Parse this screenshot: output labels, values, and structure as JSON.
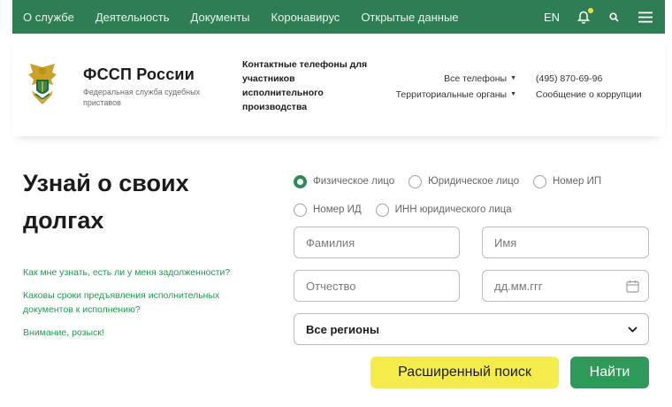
{
  "nav": {
    "items": [
      "О службе",
      "Деятельность",
      "Документы",
      "Коронавирус",
      "Открытые данные"
    ],
    "lang": "EN",
    "icons": [
      "bell-icon",
      "search-icon",
      "menu-icon"
    ]
  },
  "header": {
    "brand_name": "ФССП России",
    "brand_sub": "Федеральная служба судебных приставов",
    "contact_title": "Контактные телефоны для участников исполнительного производства",
    "all_phones": "Все телефоны",
    "territorial": "Территориальные органы",
    "phone": "(495) 870-69-96",
    "corruption": "Сообщение о коррупции"
  },
  "main": {
    "title": "Узнай о своих долгах",
    "faq": [
      "Как мне узнать, есть ли у меня задолженности?",
      "Каковы сроки предъявления исполнительных документов к исполнению?",
      "Внимание, розыск!"
    ]
  },
  "search": {
    "radios": [
      "Физическое лицо",
      "Юридическое лицо",
      "Номер ИП",
      "Номер ИД",
      "ИНН юридического лица"
    ],
    "selected": "Физическое лицо",
    "lastname_placeholder": "Фамилия",
    "firstname_placeholder": "Имя",
    "patronymic_placeholder": "Отчество",
    "date_placeholder": "дд.мм.ггг",
    "region_value": "Все регионы",
    "advanced_label": "Расширенный поиск",
    "find_label": "Найти"
  },
  "colors": {
    "brand_green": "#2f7d55",
    "button_green": "#2e9a5a",
    "button_yellow": "#f4ec4a",
    "link_green": "#1f9a54"
  }
}
